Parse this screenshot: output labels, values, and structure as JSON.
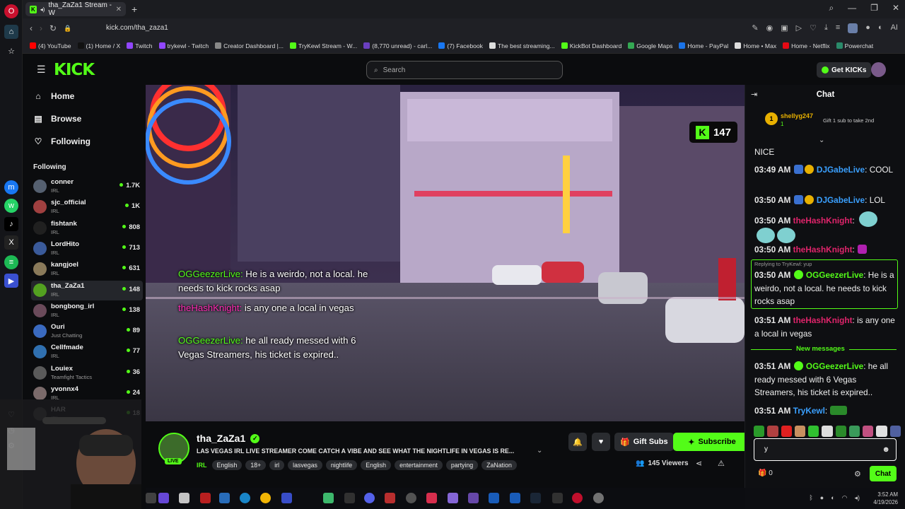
{
  "browser": {
    "tab_title": "tha_ZaZa1 Stream - W",
    "url": "kick.com/tha_zaza1",
    "ai_label": "AI",
    "bookmarks": [
      {
        "label": "(4) YouTube",
        "color": "#ff0000"
      },
      {
        "label": "(1) Home / X",
        "color": "#111111"
      },
      {
        "label": "Twitch",
        "color": "#9146ff"
      },
      {
        "label": "trykewl - Twitch",
        "color": "#9146ff"
      },
      {
        "label": "Creator Dashboard |...",
        "color": "#888888"
      },
      {
        "label": "TryKewl Stream - W...",
        "color": "#53fc18"
      },
      {
        "label": "(8,770 unread) - carl...",
        "color": "#6a3fbf"
      },
      {
        "label": "(7) Facebook",
        "color": "#1877f2"
      },
      {
        "label": "The best streaming...",
        "color": "#dddddd"
      },
      {
        "label": "KickBot Dashboard",
        "color": "#53fc18"
      },
      {
        "label": "Google Maps",
        "color": "#34a853"
      },
      {
        "label": "Home - PayPal",
        "color": "#1a73e8"
      },
      {
        "label": "Home • Max",
        "color": "#dddddd"
      },
      {
        "label": "Home - Netflix",
        "color": "#e50914"
      },
      {
        "label": "Powerchat",
        "color": "#2a8a6a"
      }
    ]
  },
  "header": {
    "logo": "KICK",
    "search_placeholder": "Search",
    "get_kicks": "Get KICKs"
  },
  "nav": {
    "home": "Home",
    "browse": "Browse",
    "following": "Following",
    "following_heading": "Following"
  },
  "following_list": [
    {
      "name": "conner",
      "category": "IRL",
      "viewers": "1.7K",
      "color": "#556070"
    },
    {
      "name": "sjc_official",
      "category": "IRL",
      "viewers": "1K",
      "color": "#a04040"
    },
    {
      "name": "fishtank",
      "category": "IRL",
      "viewers": "808",
      "color": "#202020"
    },
    {
      "name": "LordHito",
      "category": "IRL",
      "viewers": "713",
      "color": "#3a5a9a"
    },
    {
      "name": "kangjoel",
      "category": "IRL",
      "viewers": "631",
      "color": "#8a7a5a"
    },
    {
      "name": "tha_ZaZa1",
      "category": "IRL",
      "viewers": "148",
      "color": "#53a020"
    },
    {
      "name": "bongbong_irl",
      "category": "IRL",
      "viewers": "138",
      "color": "#6a4a5a"
    },
    {
      "name": "Ouri",
      "category": "Just Chatting",
      "viewers": "89",
      "color": "#3a6ac0"
    },
    {
      "name": "Cellfmade",
      "category": "IRL",
      "viewers": "77",
      "color": "#3070b0"
    },
    {
      "name": "Louiex",
      "category": "Teamfight Tactics",
      "viewers": "36",
      "color": "#5a5a5a"
    },
    {
      "name": "yvonnx4",
      "category": "IRL",
      "viewers": "24",
      "color": "#7a6a6a"
    },
    {
      "name": "HAR",
      "category": "IRL",
      "viewers": "18",
      "color": "#4a4a4a"
    }
  ],
  "video": {
    "viewer_badge": "147",
    "overlay": [
      {
        "user": "OGGeezerLive:",
        "text": " He is a weirdo, not a local. he needs to kick rocks asap"
      },
      {
        "user": "theHashKnight:",
        "text": " is any one a local in vegas"
      },
      {
        "user": "OGGeezerLive:",
        "text": " he all ready messed with 6 Vegas Streamers, his ticket is expired.."
      }
    ]
  },
  "stream": {
    "name": "tha_ZaZa1",
    "live": "LIVE",
    "title": "LAS VEGAS IRL LIVE STREAMER COME CATCH A VIBE AND SEE WHAT THE NIGHTLIFE IN VEGAS IS RE...",
    "category": "IRL",
    "tags": [
      "English",
      "18+",
      "irl",
      "lasvegas",
      "nightlife",
      "English",
      "entertainment",
      "partying",
      "ZaNation"
    ],
    "gift_subs": "Gift Subs",
    "subscribe": "Subscribe",
    "viewers": "145 Viewers"
  },
  "chat": {
    "title": "Chat",
    "pinned_user": "shellyg247",
    "pinned_badge": "1",
    "pinned_sub": "1",
    "pinned_gift": "Gift 1 sub to take 2nd",
    "messages": [
      {
        "time": "",
        "user": "",
        "text": "NICE"
      },
      {
        "time": "03:49 AM",
        "user": "DJGabeLive",
        "text": "COOL"
      },
      {
        "time": "03:50 AM",
        "user": "DJGabeLive",
        "text": "LOL"
      },
      {
        "time": "03:50 AM",
        "user": "theHashKnight",
        "text": ""
      },
      {
        "time": "03:50 AM",
        "user": "theHashKnight",
        "text": ""
      },
      {
        "time": "03:50 AM",
        "user": "OGGeezerLive",
        "text": "He is a weirdo, not a local. he needs to kick rocks asap"
      },
      {
        "time": "03:51 AM",
        "user": "theHashKnight",
        "text": "is any one a local in vegas"
      },
      {
        "time": "03:51 AM",
        "user": "OGGeezerLive",
        "text": "he all ready messed with 6 Vegas Streamers, his ticket is expired.."
      },
      {
        "time": "03:51 AM",
        "user": "TryKewl",
        "text": ""
      }
    ],
    "reply_label": "Replying to TryKewl: yup",
    "new_messages": "New messages",
    "input_value": "y",
    "kicks_count": "0",
    "send": "Chat"
  },
  "taskbar": {
    "time": "3:52 AM",
    "date": "4/19/2026"
  }
}
